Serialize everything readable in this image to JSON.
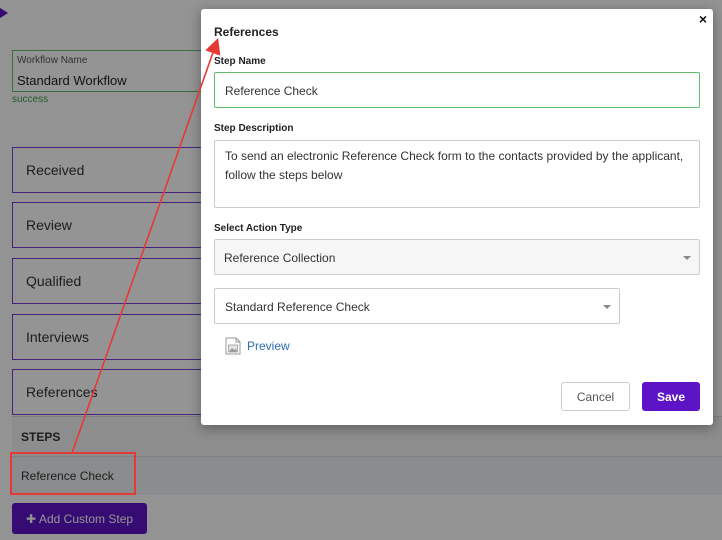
{
  "background": {
    "workflow_label": "Workflow Name",
    "workflow_value": "Standard Workflow",
    "workflow_status": "success",
    "stages": [
      "Received",
      "Review",
      "Qualified",
      "Interviews",
      "References"
    ],
    "steps_header": "STEPS",
    "step_item": "Reference Check",
    "add_step_label": "Add Custom Step"
  },
  "modal": {
    "title": "References",
    "close_glyph": "×",
    "step_name_label": "Step Name",
    "step_name_value": "Reference Check",
    "step_desc_label": "Step Description",
    "step_desc_value": "To send an electronic Reference Check form to the contacts provided by the applicant, follow the steps below",
    "action_type_label": "Select Action Type",
    "action_type_value": "Reference Collection",
    "template_value": "Standard Reference Check",
    "preview_label": "Preview",
    "cancel_label": "Cancel",
    "save_label": "Save"
  },
  "colors": {
    "accent": "#5d14c6",
    "stage_border": "#7b3fd6",
    "success": "#3c9f4a",
    "annotation": "#e53935",
    "link": "#2d6cb5"
  },
  "icons": {
    "logo": "brand-logo-icon",
    "add": "plus-icon",
    "preview": "image-file-icon",
    "close": "close-icon",
    "dropdown": "chevron-down-icon"
  }
}
